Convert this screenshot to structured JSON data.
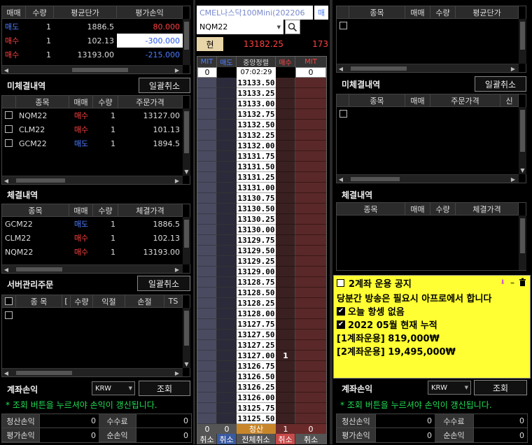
{
  "left": {
    "positions": {
      "headers": [
        "매매",
        "수량",
        "평균단가",
        "평가손익"
      ],
      "rows": [
        {
          "side": "매도",
          "qty": "1",
          "avg": "1886.5",
          "pnl": "80.000"
        },
        {
          "side": "매수",
          "qty": "1",
          "avg": "102.13",
          "pnl": "-300.000"
        },
        {
          "side": "매수",
          "qty": "1",
          "avg": "13193.00",
          "pnl": "-215.000"
        }
      ]
    },
    "unfilled": {
      "title": "미체결내역",
      "cancel_all": "일괄취소",
      "headers": [
        "종목",
        "매매",
        "수량",
        "주문가격"
      ],
      "rows": [
        {
          "symbol": "NQM22",
          "side": "매수",
          "qty": "1",
          "price": "13127.00"
        },
        {
          "symbol": "CLM22",
          "side": "매수",
          "qty": "1",
          "price": "101.13"
        },
        {
          "symbol": "GCM22",
          "side": "매도",
          "qty": "1",
          "price": "1894.5"
        }
      ]
    },
    "filled": {
      "title": "체결내역",
      "headers": [
        "종목",
        "매매",
        "수량",
        "체결가격"
      ],
      "rows": [
        {
          "symbol": "GCM22",
          "side": "매도",
          "qty": "1",
          "price": "1886.5"
        },
        {
          "symbol": "CLM22",
          "side": "매수",
          "qty": "1",
          "price": "102.13"
        },
        {
          "symbol": "NQM22",
          "side": "매수",
          "qty": "1",
          "price": "13193.00"
        }
      ]
    },
    "server": {
      "title": "서버관리주문",
      "cancel_all": "일괄취소",
      "headers": [
        "종 목",
        "[",
        "수량",
        "익절",
        "손절",
        "TS"
      ]
    },
    "account": {
      "title": "계좌손익",
      "currency": "KRW",
      "query": "조회",
      "hint": "* 조회 버튼을 누르셔야 손익이 갱신됩니다.",
      "labels": [
        "청산손익",
        "수수료",
        "평가손익",
        "순손익"
      ],
      "values": [
        "0",
        "0",
        "0",
        "0"
      ]
    }
  },
  "middle": {
    "product_name": "CMEL나스닥100Mini(202206",
    "product_tail": "매",
    "symbol": "NQM22",
    "current_label": "현",
    "current_price": "13182.25",
    "current_tail": "173",
    "ladder_headers": [
      "MIT",
      "매도",
      "중앙정렬",
      "매수",
      "MIT"
    ],
    "top_counts": {
      "mit_left": "0",
      "time": "07:02:29",
      "mit_right": "0"
    },
    "prices": [
      "13133.50",
      "13133.25",
      "13133.00",
      "13132.75",
      "13132.50",
      "13132.25",
      "13132.00",
      "13131.75",
      "13131.50",
      "13131.25",
      "13131.00",
      "13130.75",
      "13130.50",
      "13130.25",
      "13130.00",
      "13129.75",
      "13129.50",
      "13129.25",
      "13129.00",
      "13128.75",
      "13128.50",
      "13128.25",
      "13128.00",
      "13127.75",
      "13127.50",
      "13127.25",
      "13127.00",
      "13126.75",
      "13126.50",
      "13126.25",
      "13126.00",
      "13125.75",
      "13125.50"
    ],
    "order_marker": "1",
    "bottom": {
      "c1": "0",
      "c2": "0",
      "mid": "청산",
      "c4": "1",
      "c5": "0"
    },
    "cancel_buttons": [
      "취소",
      "취소",
      "전체취소",
      "취소",
      "취소"
    ]
  },
  "right": {
    "positions_headers": [
      "종목",
      "매매",
      "수량",
      "평균단가"
    ],
    "unfilled": {
      "title": "미체결내역",
      "cancel_all": "일괄취소",
      "headers": [
        "종목",
        "매매",
        "주문가격",
        "신"
      ]
    },
    "filled": {
      "title": "체결내역",
      "headers": [
        "종목",
        "매매",
        "수량",
        "체결가격"
      ]
    },
    "notice": {
      "title": "2계좌 운용 공지",
      "lines": [
        "당분간 방송은 필요시 아프로에서 합니다",
        "오늘 항셍 없음",
        "2022 05월 현재 누적",
        "[1계좌운용] 819,000₩",
        "[2계좌운용] 19,495,000₩"
      ]
    },
    "account": {
      "title": "계좌손익",
      "currency": "KRW",
      "query": "조회",
      "hint": "* 조회 버튼을 누르셔야 손익이 갱신됩니다.",
      "labels": [
        "청산손익",
        "수수료",
        "평가손익",
        "순손익"
      ],
      "values": [
        "0",
        "0",
        "0",
        "0"
      ]
    }
  },
  "colors": {
    "sell": "#4d7dff",
    "buy": "#ff4040",
    "notice_bg": "#ffff33"
  }
}
